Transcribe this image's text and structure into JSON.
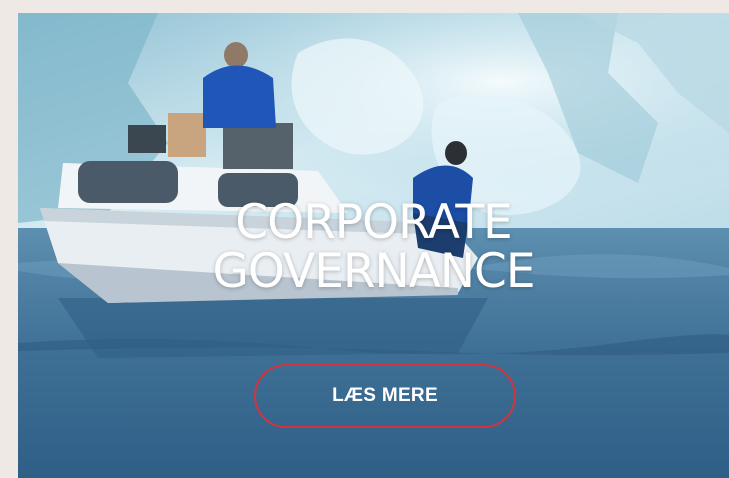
{
  "hero": {
    "title_line_1": "CORPORATE",
    "title_line_2": "GOVERNANCE",
    "cta_label": "LÆS MERE"
  },
  "colors": {
    "page_background": "#efe9e6",
    "cta_border": "#d1343f",
    "headline_text": "#ffffff"
  }
}
